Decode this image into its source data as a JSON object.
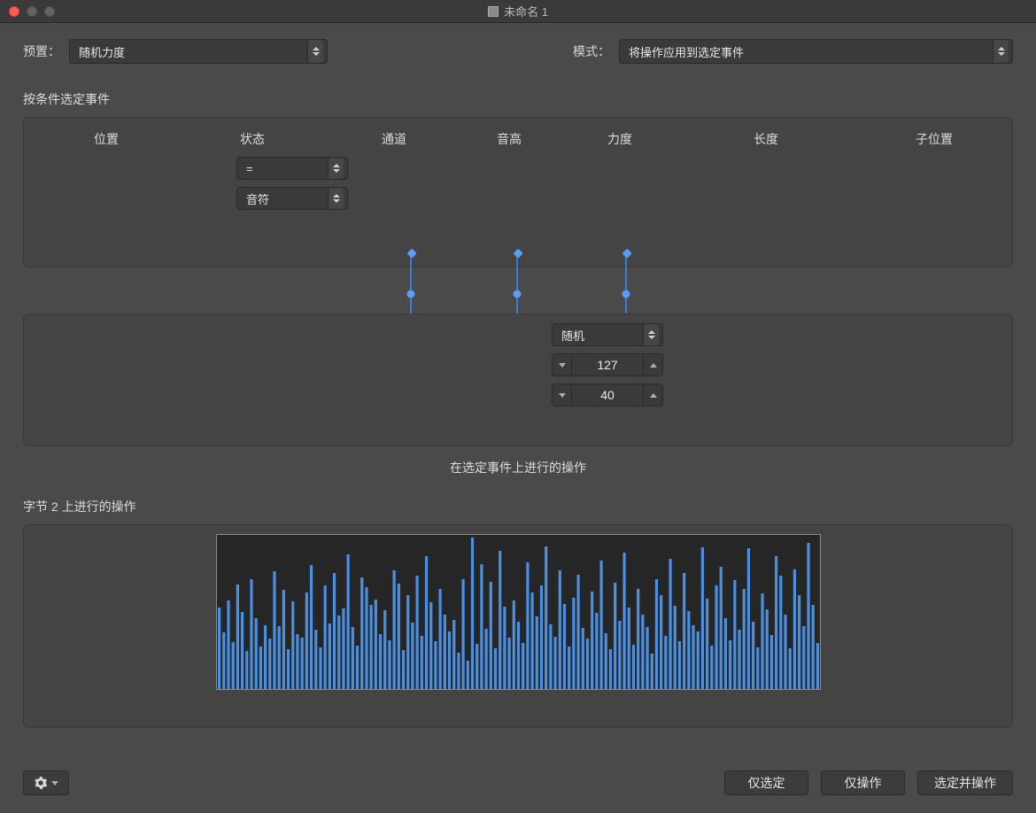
{
  "window": {
    "title": "未命名 1"
  },
  "top": {
    "preset_label": "预置：",
    "preset_value": "随机力度",
    "mode_label": "模式：",
    "mode_value": "将操作应用到选定事件"
  },
  "conditions": {
    "title": "按条件选定事件",
    "headers": [
      "位置",
      "状态",
      "通道",
      "音高",
      "力度",
      "长度",
      "子位置"
    ],
    "status_operator": "=",
    "status_type": "音符"
  },
  "operations": {
    "velocity_mode": "随机",
    "velocity_max": "127",
    "velocity_min": "40",
    "caption": "在选定事件上进行的操作"
  },
  "preview": {
    "title": "字节 2 上进行的操作",
    "bar_values": [
      92,
      64,
      100,
      53,
      118,
      87,
      43,
      124,
      80,
      48,
      72,
      57,
      133,
      71,
      112,
      45,
      99,
      62,
      58,
      109,
      140,
      67,
      47,
      117,
      74,
      131,
      83,
      91,
      152,
      70,
      49,
      126,
      115,
      95,
      101,
      62,
      89,
      55,
      134,
      119,
      44,
      106,
      75,
      128,
      60,
      150,
      98,
      54,
      113,
      84,
      65,
      78,
      41,
      124,
      32,
      171,
      51,
      141,
      68,
      121,
      46,
      156,
      93,
      58,
      100,
      76,
      52,
      143,
      109,
      82,
      117,
      161,
      73,
      59,
      134,
      96,
      48,
      103,
      129,
      69,
      57,
      110,
      86,
      145,
      63,
      45,
      120,
      77,
      154,
      92,
      50,
      113,
      84,
      70,
      40,
      124,
      106,
      60,
      147,
      94,
      54,
      131,
      88,
      72,
      65,
      160,
      102,
      49,
      117,
      138,
      80,
      55,
      123,
      67,
      113,
      159,
      76,
      47,
      108,
      90,
      61,
      150,
      128,
      84,
      46,
      135,
      106,
      71,
      165,
      95,
      52
    ]
  },
  "footer": {
    "select_only": "仅选定",
    "operate_only": "仅操作",
    "select_and_operate": "选定并操作"
  }
}
